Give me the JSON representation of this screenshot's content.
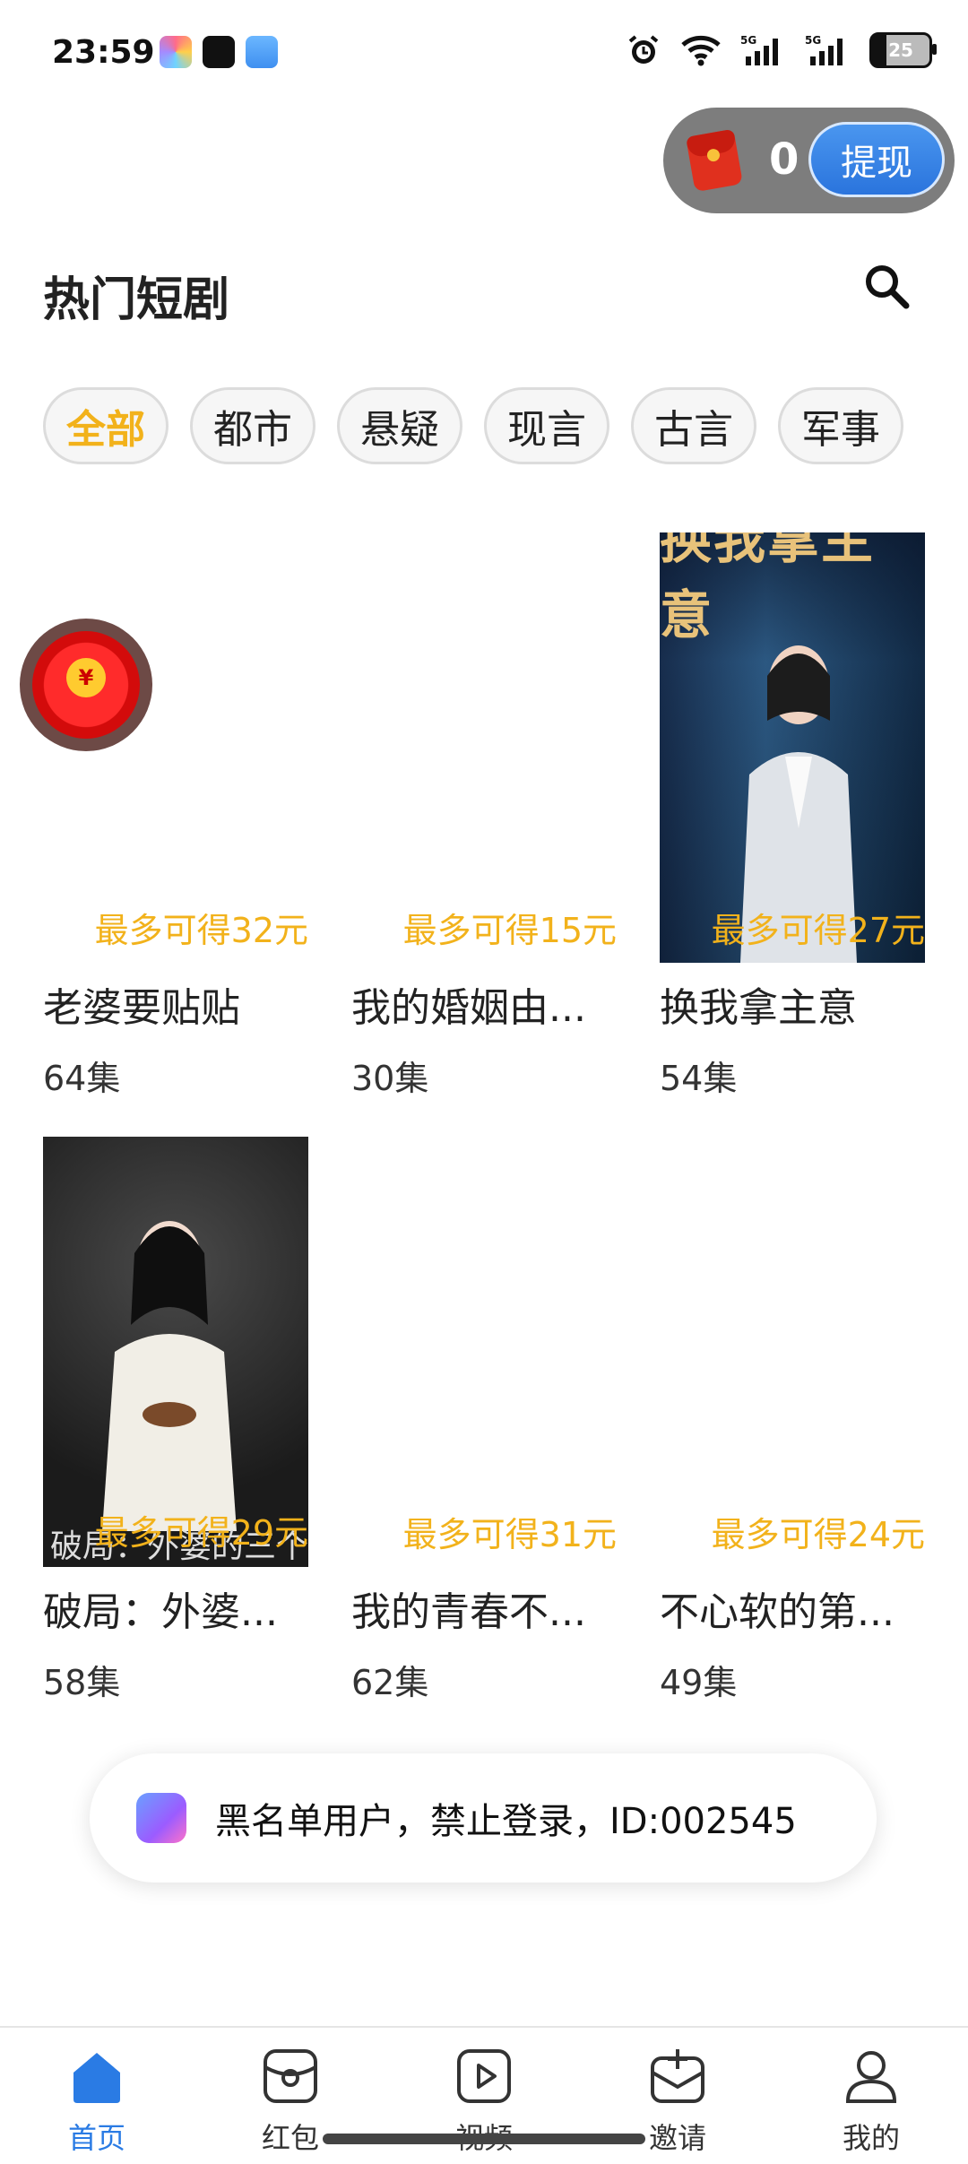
{
  "status_bar": {
    "time": "23:59",
    "battery": "25"
  },
  "wallet": {
    "count": "0",
    "withdraw_label": "提现"
  },
  "header": {
    "title": "热门短剧"
  },
  "categories": [
    {
      "label": "全部",
      "active": true
    },
    {
      "label": "都市"
    },
    {
      "label": "悬疑"
    },
    {
      "label": "现言"
    },
    {
      "label": "古言"
    },
    {
      "label": "军事"
    }
  ],
  "dramas": [
    {
      "title": "老婆要贴贴",
      "episodes": "64集",
      "reward": "最多可得32元"
    },
    {
      "title": "我的婚姻由...",
      "episodes": "30集",
      "reward": "最多可得15元"
    },
    {
      "title": "换我拿主意",
      "episodes": "54集",
      "reward": "最多可得27元",
      "poster_text": "换我拿主意"
    },
    {
      "title": "破局：外婆...",
      "episodes": "58集",
      "reward": "最多可得29元",
      "poster_text": "破局：外婆的三个核"
    },
    {
      "title": "我的青春不...",
      "episodes": "62集",
      "reward": "最多可得31元"
    },
    {
      "title": "不心软的第...",
      "episodes": "49集",
      "reward": "最多可得24元"
    }
  ],
  "floating_redpack": {
    "symbol": "¥"
  },
  "toast": {
    "message": "黑名单用户，禁止登录，ID:002545"
  },
  "bottom_nav": [
    {
      "label": "首页",
      "icon": "home-icon",
      "active": true
    },
    {
      "label": "红包",
      "icon": "redpack-icon"
    },
    {
      "label": "视频",
      "icon": "video-icon"
    },
    {
      "label": "邀请",
      "icon": "invite-icon"
    },
    {
      "label": "我的",
      "icon": "profile-icon"
    }
  ],
  "colors": {
    "accent": "#f2b21b",
    "nav_active": "#2a7be4",
    "withdraw": "#2a74dd"
  }
}
